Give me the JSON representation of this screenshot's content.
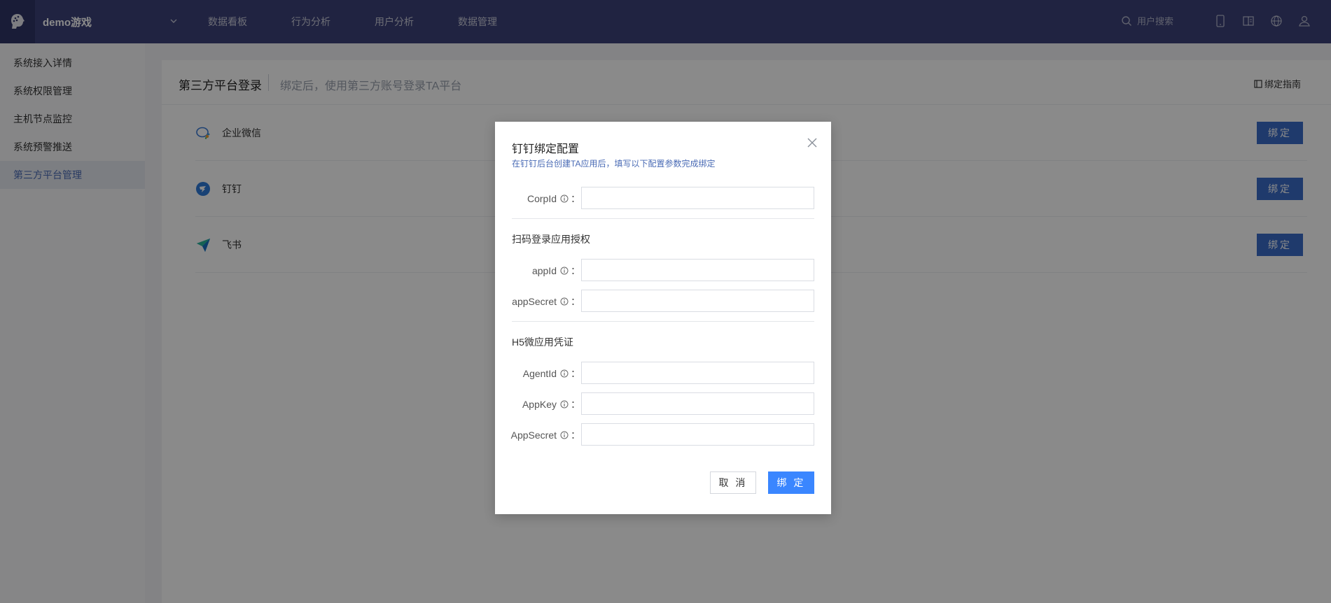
{
  "topbar": {
    "logo_icon": "brain-head-icon",
    "project_name": "demo游戏",
    "nav": [
      {
        "label": "数据看板"
      },
      {
        "label": "行为分析"
      },
      {
        "label": "用户分析"
      },
      {
        "label": "数据管理"
      }
    ],
    "search_placeholder": "用户搜索",
    "icons": [
      "mobile-icon",
      "book-icon",
      "globe-icon",
      "user-icon"
    ]
  },
  "sidebar": {
    "items": [
      {
        "label": "系统接入详情",
        "active": false
      },
      {
        "label": "系统权限管理",
        "active": false
      },
      {
        "label": "主机节点监控",
        "active": false
      },
      {
        "label": "系统预警推送",
        "active": false
      },
      {
        "label": "第三方平台管理",
        "active": true
      }
    ]
  },
  "panel": {
    "title": "第三方平台登录",
    "subtitle": "绑定后，使用第三方账号登录TA平台",
    "guide_label": "绑定指南",
    "platforms": [
      {
        "name": "企业微信",
        "icon": "wecom-icon",
        "button": "绑定"
      },
      {
        "name": "钉钉",
        "icon": "dingtalk-icon",
        "button": "绑定"
      },
      {
        "name": "飞书",
        "icon": "feishu-icon",
        "button": "绑定"
      }
    ]
  },
  "modal": {
    "title": "钉钉绑定配置",
    "description": "在钉钉后台创建TA应用后，填写以下配置参数完成绑定",
    "fields": {
      "corpid": {
        "label": "CorpId",
        "value": ""
      },
      "appid": {
        "label": "appId",
        "value": ""
      },
      "appsecret": {
        "label": "appSecret",
        "value": ""
      },
      "agentid": {
        "label": "AgentId",
        "value": ""
      },
      "appkey": {
        "label": "AppKey",
        "value": ""
      },
      "appsecret2": {
        "label": "AppSecret",
        "value": ""
      }
    },
    "sections": {
      "scan": "扫码登录应用授权",
      "h5": "H5微应用凭证"
    },
    "colon": "：",
    "cancel_label": "取 消",
    "confirm_label": "绑 定"
  },
  "colors": {
    "topbar": "#3b4178",
    "accent": "#3a6cc8",
    "primary": "#3a86ff",
    "sidebar_active_text": "#4a6bb5"
  }
}
